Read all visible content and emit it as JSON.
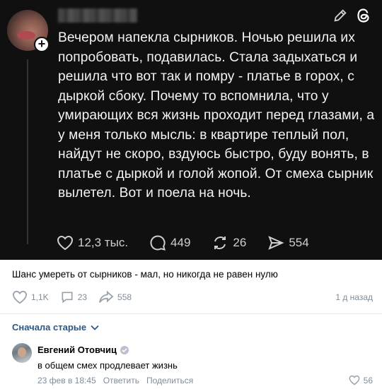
{
  "threads_post": {
    "text": "Вечером напекла сырников. Ночью решила их попробовать, подавилась. Стала задыхаться и решила что вот так и помру - платье в горох, с дыркой сбоку. Почему то вспомнила, что у умирающих вся жизнь проходит перед глазами, а у меня только мысль: в квартире теплый пол, найдут не скоро, вздуюсь быстро, буду вонять, в платье с дыркой и голой жопой. От смеха сырник вылетел. Вот и поела на ночь.",
    "likes": "12,3 тыс.",
    "comments": "449",
    "reposts": "26",
    "shares": "554",
    "colors": {
      "background": "#101010",
      "text": "#f3f3f3"
    }
  },
  "vk_post": {
    "caption": "Шанс умереть от сырников - мал, но никогда не равен нулю",
    "likes": "1,1K",
    "comments": "23",
    "shares": "558",
    "time": "1 д назад"
  },
  "comments_section": {
    "sort_label": "Сначала старые"
  },
  "comment": {
    "author": "Евгений Отовчиц",
    "text": "в общем смех продлевает жизнь",
    "date": "23 фев в 18:45",
    "reply_label": "Ответить",
    "share_label": "Поделиться",
    "likes": "56"
  },
  "icons": [
    "edit-icon",
    "threads-logo-icon",
    "heart-icon",
    "comment-icon",
    "repost-icon",
    "share-icon",
    "chevron-down-icon",
    "verified-icon"
  ],
  "accent": "#2a5885"
}
